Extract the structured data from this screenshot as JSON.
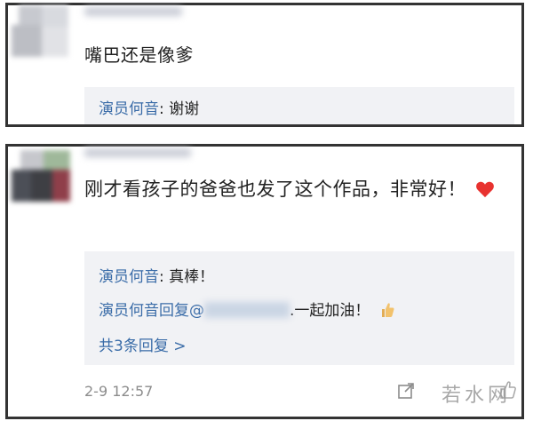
{
  "comments": [
    {
      "text": "嘴巴还是像爹",
      "replies": [
        {
          "author": "演员何音",
          "text": ": 谢谢"
        }
      ]
    },
    {
      "text": "刚才看孩子的爸爸也发了这个作品，非常好！",
      "replies": [
        {
          "author": "演员何音",
          "text": ": 真棒！"
        },
        {
          "author": "演员何音",
          "prefix": "回复@",
          "text": ".一起加油！"
        }
      ],
      "more_replies": "共3条回复 >",
      "timestamp": "2-9 12:57"
    }
  ],
  "watermark": "若水网",
  "icons": {
    "heart": "heart-icon",
    "thumbs_up": "thumbs-up-icon",
    "share": "share-icon",
    "like": "like-icon"
  },
  "colors": {
    "link": "#3a6ca8",
    "reply_background": "#f1f2f5",
    "heart": "#e8322f"
  }
}
